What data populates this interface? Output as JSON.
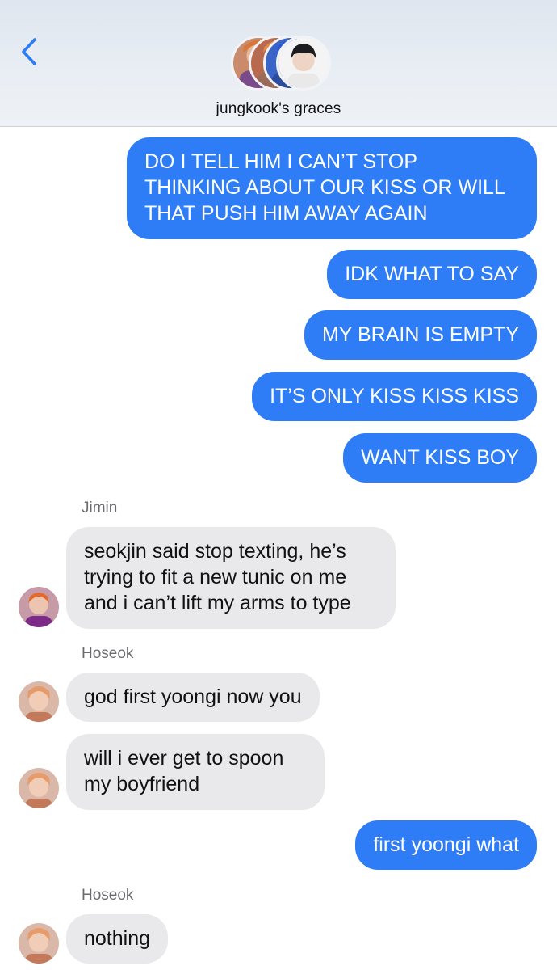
{
  "header": {
    "group_name": "jungkook's graces",
    "back_icon": "chevron-left-icon",
    "accent": "#2f7df6"
  },
  "colors": {
    "sent_bubble": "#2f7df6",
    "received_bubble": "#e9e9eb"
  },
  "messages": [
    {
      "from": "me",
      "lines": [
        "DO I TELL HIM I CAN’T STOP",
        "THINKING ABOUT OUR KISS OR WILL",
        "THAT PUSH HIM AWAY AGAIN"
      ]
    },
    {
      "from": "me",
      "lines": [
        "IDK WHAT TO SAY"
      ]
    },
    {
      "from": "me",
      "lines": [
        "MY BRAIN IS EMPTY"
      ]
    },
    {
      "from": "me",
      "lines": [
        "IT’S ONLY KISS KISS KISS"
      ]
    },
    {
      "from": "me",
      "lines": [
        "WANT KISS BOY"
      ]
    },
    {
      "from": "Jimin",
      "sender_label": "Jimin",
      "lines": [
        "seokjin said stop texting, he’s",
        "trying to fit a new tunic on me",
        "and i can’t lift my arms to type"
      ]
    },
    {
      "from": "Hoseok",
      "sender_label": "Hoseok",
      "lines": [
        "god first yoongi now you"
      ]
    },
    {
      "from": "Hoseok",
      "lines": [
        "will i ever get to spoon",
        "my boyfriend"
      ]
    },
    {
      "from": "me",
      "lines": [
        "first yoongi what"
      ]
    },
    {
      "from": "Hoseok",
      "sender_label": "Hoseok",
      "lines": [
        "nothing"
      ]
    }
  ]
}
